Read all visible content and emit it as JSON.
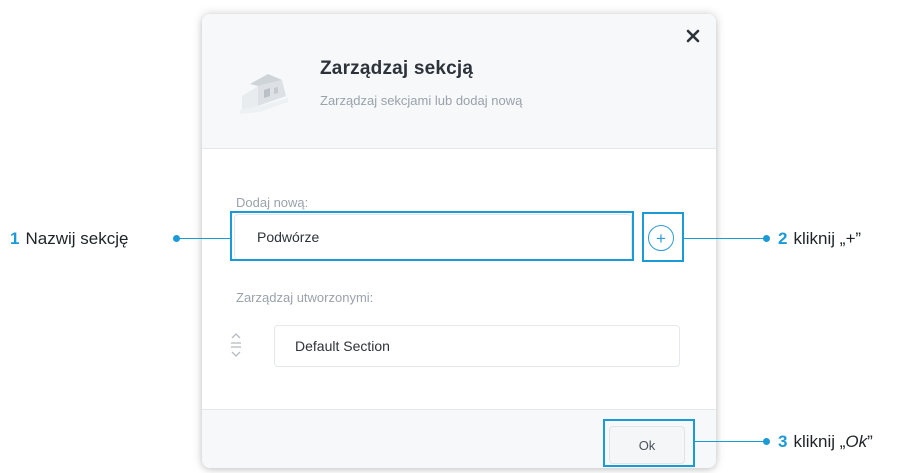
{
  "dialog": {
    "title": "Zarządzaj sekcją",
    "subtitle": "Zarządzaj sekcjami lub dodaj nową",
    "close_icon": "close-icon",
    "illustration_icon": "house-illustration-icon"
  },
  "add_section": {
    "label": "Dodaj nową:",
    "input_value": "Podwórze",
    "add_button_label": "+"
  },
  "manage_sections": {
    "label": "Zarządzaj utworzonymi:",
    "items": [
      {
        "name": "Default Section",
        "handle_icon": "drag-handle-icon"
      }
    ]
  },
  "footer": {
    "ok_label": "Ok"
  },
  "callouts": [
    {
      "number": "1",
      "text": "Nazwij sekcję",
      "suffix": ""
    },
    {
      "number": "2",
      "text": "kliknij „",
      "emphasis": "+",
      "suffix": "”"
    },
    {
      "number": "3",
      "text": "kliknij „",
      "emphasis": "Ok",
      "suffix": "”"
    }
  ],
  "colors": {
    "accent": "#1b9ad8",
    "header_background": "#f6f8fa"
  }
}
